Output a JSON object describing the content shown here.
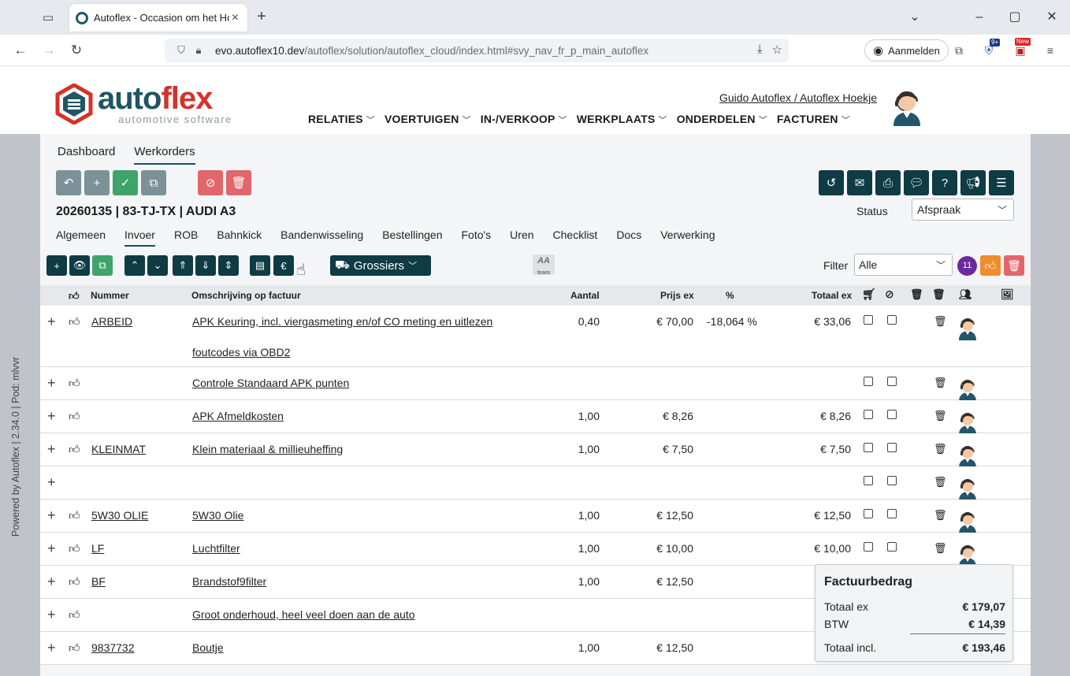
{
  "browser": {
    "tab_title": "Autoflex - Occasion om het Hoekje",
    "url_host": "evo.autoflex10.dev",
    "url_prefix": "",
    "url_path": "/autoflex/solution/autoflex_cloud/index.html#svy_nav_fr_p_main_autoflex",
    "signin_label": "Aanmelden",
    "ext_badge_1": "9+",
    "ext_badge_2": "New"
  },
  "header": {
    "logo_main_a": "auto",
    "logo_main_b": "flex",
    "logo_sub": "automotive software",
    "user_link": "Guido Autoflex / Autoflex Hoekje",
    "menu": [
      "RELATIES",
      "VOERTUIGEN",
      "IN-/VERKOOP",
      "WERKPLAATS",
      "ONDERDELEN",
      "FACTUREN"
    ]
  },
  "sidebar": {
    "powered_text": "Powered by Autoflex | 2.34.0 | Pod: mlvvr"
  },
  "subtabs": [
    "Dashboard",
    "Werkorders"
  ],
  "workorder": {
    "title": "20260135 | 83-TJ-TX | AUDI A3",
    "status_label": "Status",
    "status_value": "Afspraak",
    "tabs": [
      "Algemeen",
      "Invoer",
      "ROB",
      "Bahnkick",
      "Bandenwisseling",
      "Bestellingen",
      "Foto's",
      "Uren",
      "Checklist",
      "Docs",
      "Verwerking"
    ],
    "active_tab": "Invoer"
  },
  "toolbar": {
    "grossiers_label": "Grossiers",
    "aa_logo": "AA",
    "aa_sub": "team",
    "filter_label": "Filter",
    "filter_value": "Alle",
    "count_badge": "11"
  },
  "table": {
    "headers": {
      "nummer": "Nummer",
      "omschrijving": "Omschrijving op factuur",
      "aantal": "Aantal",
      "prijs": "Prijs ex",
      "pct": "%",
      "totaal": "Totaal ex"
    },
    "rows": [
      {
        "nummer": "ARBEID",
        "omschrijving": "APK Keuring, incl. viergasmeting en/of CO meting en uitlezen ",
        "omschrijving2": "foutcodes via OBD2 ",
        "aantal": "0,40",
        "prijs": "€ 70,00",
        "pct": "-18,064 %",
        "totaal": "€ 33,06",
        "thumb": true,
        "trash": true
      },
      {
        "nummer": "",
        "omschrijving": "Controle Standaard APK punten",
        "omschrijving2": "",
        "aantal": "",
        "prijs": "",
        "pct": "",
        "totaal": "",
        "thumb": true,
        "trash": true
      },
      {
        "nummer": "",
        "omschrijving": "APK Afmeldkosten",
        "omschrijving2": "",
        "aantal": "1,00",
        "prijs": "€ 8,26",
        "pct": "",
        "totaal": "€ 8,26",
        "thumb": true,
        "trash": true
      },
      {
        "nummer": "KLEINMAT",
        "omschrijving": "Klein materiaal & millieuheffing",
        "omschrijving2": "",
        "aantal": "1,00",
        "prijs": "€ 7,50",
        "pct": "",
        "totaal": "€ 7,50",
        "thumb": true,
        "trash": true
      },
      {
        "nummer": "",
        "omschrijving": "",
        "omschrijving2": "",
        "aantal": "",
        "prijs": "",
        "pct": "",
        "totaal": "",
        "thumb": false,
        "trash": true
      },
      {
        "nummer": "5W30 OLIE",
        "omschrijving": "5W30 Olie",
        "omschrijving2": "",
        "aantal": "1,00",
        "prijs": "€ 12,50",
        "pct": "",
        "totaal": "€ 12,50",
        "thumb": true,
        "trash": true
      },
      {
        "nummer": "LF",
        "omschrijving": "Luchtfilter",
        "omschrijving2": "",
        "aantal": "1,00",
        "prijs": "€ 10,00",
        "pct": "",
        "totaal": "€ 10,00",
        "thumb": true,
        "trash": true
      },
      {
        "nummer": "BF",
        "omschrijving": "Brandstof9filter",
        "omschrijving2": "",
        "aantal": "1,00",
        "prijs": "€ 12,50",
        "pct": "",
        "totaal": "",
        "thumb": true,
        "trash": false
      },
      {
        "nummer": "",
        "omschrijving": "Groot onderhoud, heel veel doen aan de auto",
        "omschrijving2": "",
        "aantal": "",
        "prijs": "",
        "pct": "",
        "totaal": "",
        "thumb": true,
        "trash": false
      },
      {
        "nummer": "9837732",
        "omschrijving": "Boutje",
        "omschrijving2": "",
        "aantal": "1,00",
        "prijs": "€ 12,50",
        "pct": "",
        "totaal": "",
        "thumb": true,
        "trash": false
      }
    ]
  },
  "invoice": {
    "title": "Factuurbedrag",
    "totaal_ex_label": "Totaal ex",
    "totaal_ex": "€ 179,07",
    "btw_label": "BTW",
    "btw": "€ 14,39",
    "totaal_incl_label": "Totaal incl.",
    "totaal_incl": "€ 193,46"
  },
  "colors": {
    "brand_dark": "#0e3b44",
    "brand_red": "#d6312b",
    "accent_green": "#3ea46a",
    "delete_red": "#e2666a",
    "badge_purple": "#6b2b9a",
    "orange": "#f08c2e"
  }
}
